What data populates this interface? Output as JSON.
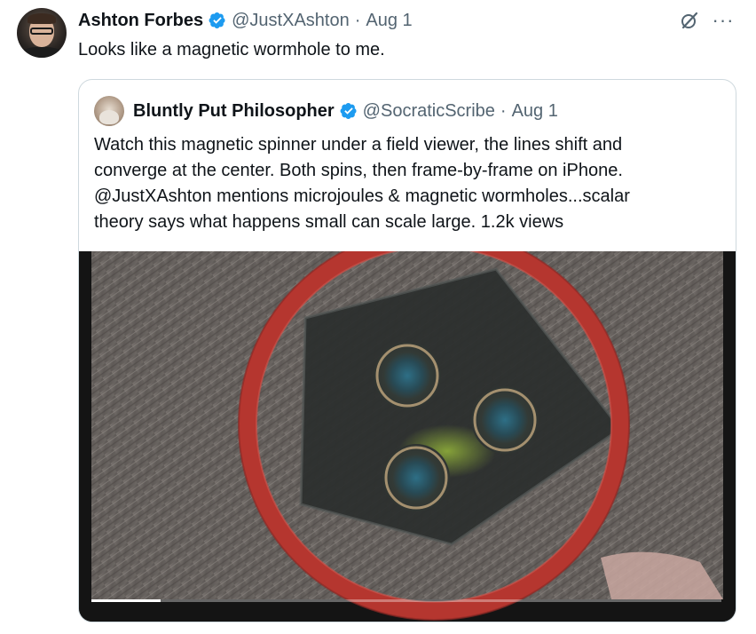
{
  "tweet": {
    "author_name": "Ashton Forbes",
    "handle": "@JustXAshton",
    "separator": "·",
    "date": "Aug 1",
    "text": "Looks like a magnetic wormhole to me.",
    "avatar_icon": "user-avatar-photo"
  },
  "actions": {
    "grok_icon": "grok-icon",
    "more_label": "···"
  },
  "quote": {
    "author_name": "Bluntly Put Philosopher",
    "handle": "@SocraticScribe",
    "separator": "·",
    "date": "Aug 1",
    "avatar_icon": "philosopher-bust-avatar",
    "lines": [
      "Watch this magnetic spinner under a field viewer, the lines shift and",
      "converge at the center. Both spins, then frame-by-frame on iPhone.",
      "@JustXAshton mentions microjoules & magnetic wormholes...scalar",
      "theory says what happens small can scale large. 1.2k views"
    ],
    "video": {
      "description_icon": "magnetic-field-viewer-video",
      "progress": 0.11
    }
  },
  "colors": {
    "verified_blue": "#1d9bf0",
    "muted_text": "#536471",
    "border": "#cfd9de",
    "ring_red": "#b5362f"
  }
}
